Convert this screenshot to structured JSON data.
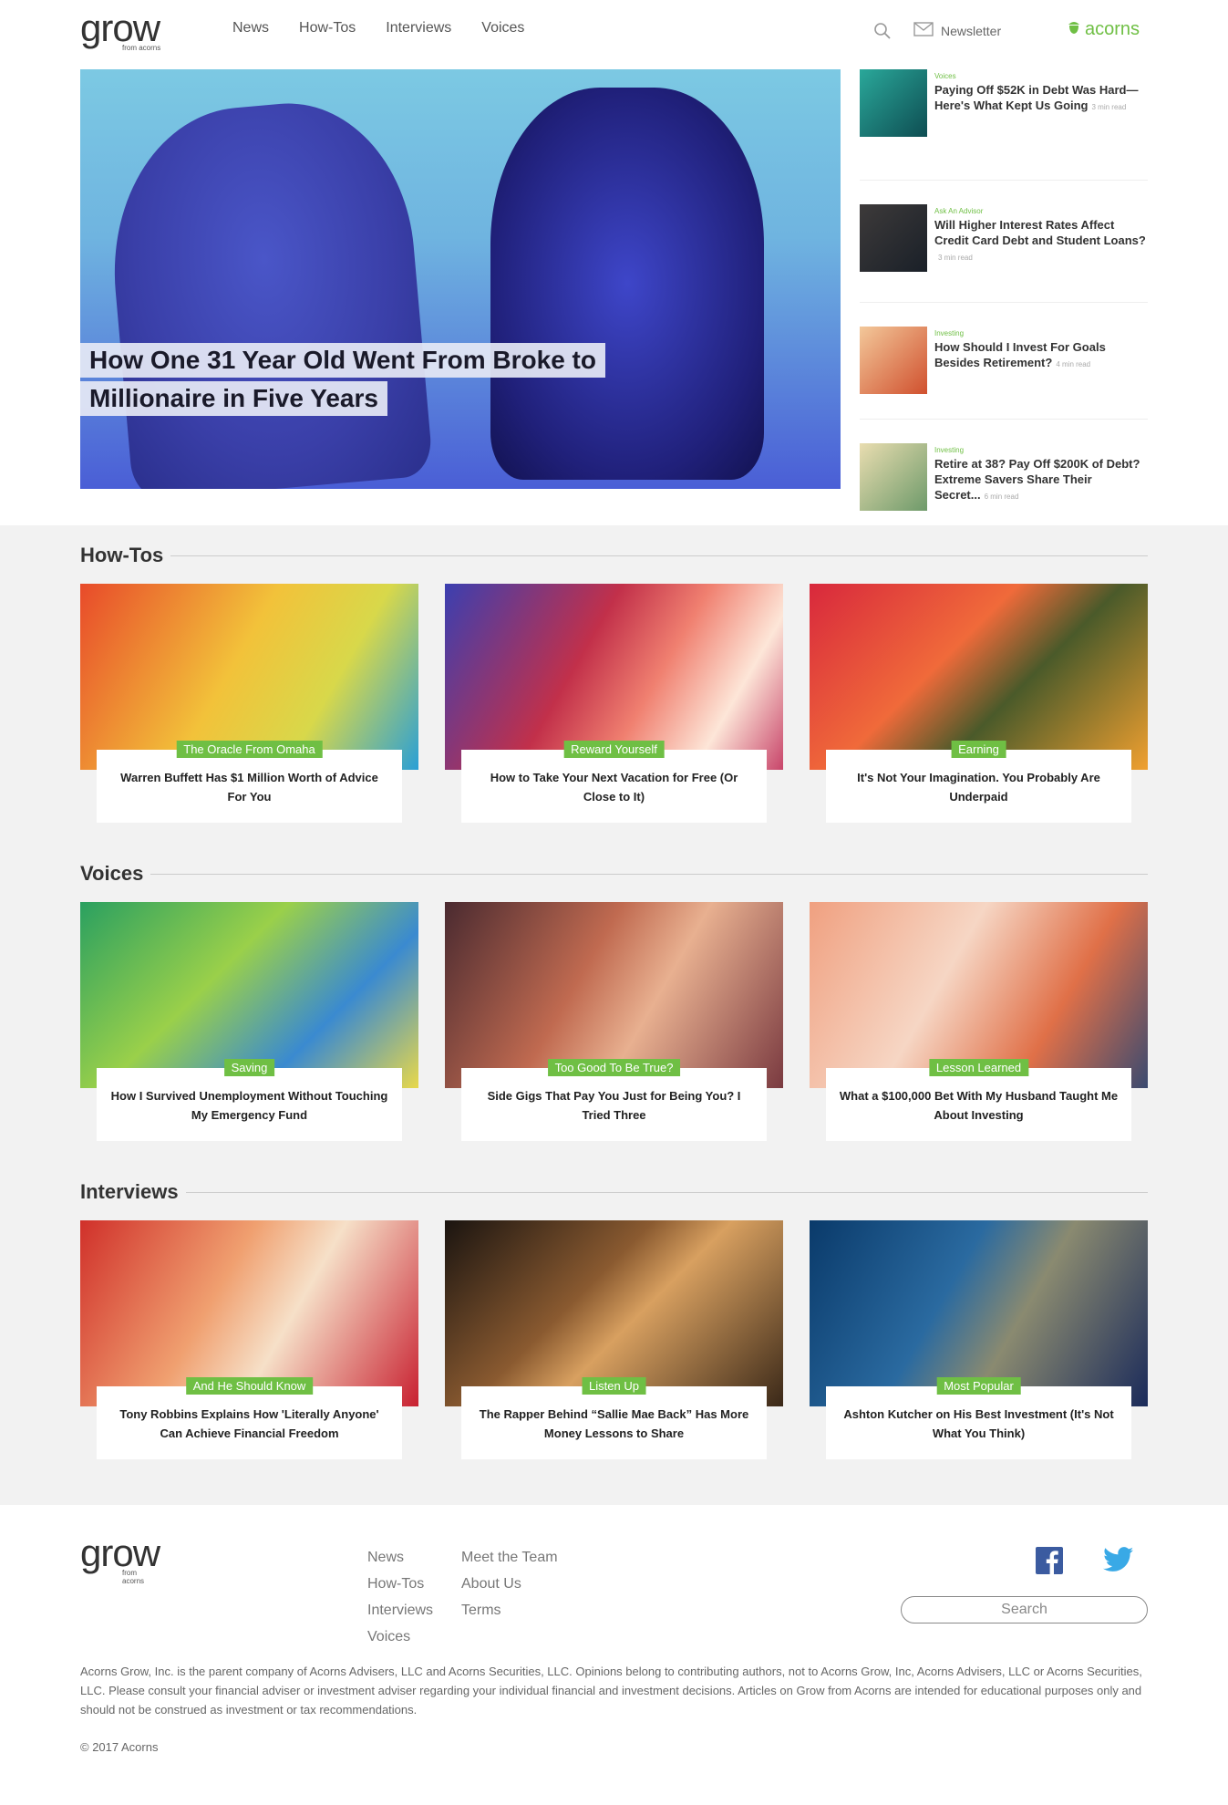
{
  "header": {
    "logo": "grow",
    "logo_sub": "from acorns",
    "nav": [
      "News",
      "How-Tos",
      "Interviews",
      "Voices"
    ],
    "newsletter": "Newsletter",
    "brand": "acorns"
  },
  "hero": {
    "title_line1": "How One 31 Year Old Went From Broke to",
    "title_line2": "Millionaire in Five Years"
  },
  "sidebar": {
    "items": [
      {
        "category": "Voices",
        "title": "Paying Off $52K in Debt Was Hard—Here's What Kept Us Going",
        "read": "3 min read"
      },
      {
        "category": "Ask An Advisor",
        "title": "Will Higher Interest Rates Affect Credit Card Debt and Student Loans?",
        "read": "3 min read"
      },
      {
        "category": "Investing",
        "title": "How Should I Invest For Goals Besides Retirement?",
        "read": "4 min read"
      },
      {
        "category": "Investing",
        "title": "Retire at 38? Pay Off $200K of Debt? Extreme Savers Share Their Secret...",
        "read": "6 min read"
      }
    ]
  },
  "sections": [
    {
      "title": "How-Tos",
      "cards": [
        {
          "tag": "The Oracle From Omaha",
          "title": "Warren Buffett Has $1 Million Worth of Advice For You"
        },
        {
          "tag": "Reward Yourself",
          "title": "How to Take Your Next Vacation for Free (Or Close to It)"
        },
        {
          "tag": "Earning",
          "title": "It's Not Your Imagination. You Probably Are Underpaid"
        }
      ]
    },
    {
      "title": "Voices",
      "cards": [
        {
          "tag": "Saving",
          "title": "How I Survived Unemployment Without Touching My Emergency Fund"
        },
        {
          "tag": "Too Good To Be True?",
          "title": "Side Gigs That Pay You Just for Being You? I Tried Three"
        },
        {
          "tag": "Lesson Learned",
          "title": "What a $100,000 Bet With My Husband Taught Me About Investing"
        }
      ]
    },
    {
      "title": "Interviews",
      "cards": [
        {
          "tag": "And He Should Know",
          "title": "Tony Robbins Explains How 'Literally Anyone' Can Achieve Financial Freedom"
        },
        {
          "tag": "Listen Up",
          "title": "The Rapper Behind “Sallie Mae Back” Has More Money Lessons to Share"
        },
        {
          "tag": "Most Popular",
          "title": "Ashton Kutcher on His Best Investment (It's Not What You Think)"
        }
      ]
    }
  ],
  "footer": {
    "col1": [
      "News",
      "How-Tos",
      "Interviews",
      "Voices"
    ],
    "col2": [
      "Meet the Team",
      "About Us",
      "Terms"
    ],
    "search_placeholder": "Search",
    "disclaimer": "Acorns Grow, Inc. is the parent company of Acorns Advisers, LLC and Acorns Securities, LLC. Opinions belong to contributing authors, not to Acorns Grow, Inc, Acorns Advisers, LLC or Acorns Securities, LLC. Please consult your financial adviser or investment adviser regarding your individual financial and investment decisions. Articles on Grow from Acorns are intended for educational purposes only and should not be construed as investment or tax recommendations.",
    "copyright": "© 2017 Acorns"
  },
  "colors": {
    "accent": "#6fbf44",
    "section_bg": "#f2f2f2"
  }
}
